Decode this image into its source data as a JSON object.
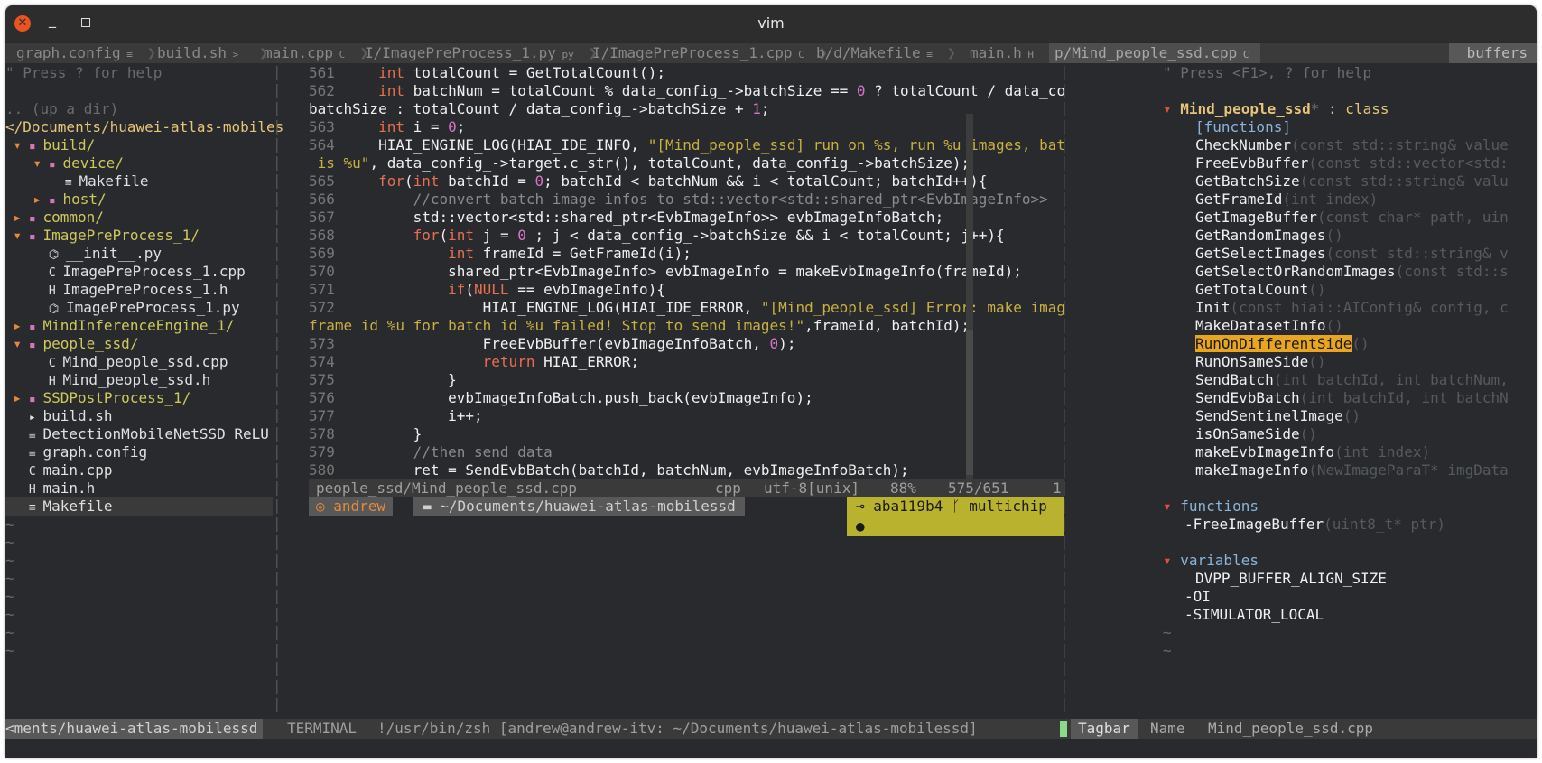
{
  "window": {
    "title": "vim"
  },
  "tabs": [
    {
      "name": "graph.config",
      "icon": "≡"
    },
    {
      "name": "build.sh",
      "icon": ">_"
    },
    {
      "name": "main.cpp",
      "icon": "C"
    },
    {
      "name": "I/ImagePreProcess_1.py",
      "icon": "py"
    },
    {
      "name": "I/ImagePreProcess_1.cpp",
      "icon": "C"
    },
    {
      "name": "b/d/Makefile",
      "icon": "≡"
    },
    {
      "name": "main.h",
      "icon": "H"
    },
    {
      "name": "p/Mind_people_ssd.cpp",
      "icon": "C"
    }
  ],
  "buffers_label": "buffers",
  "tree": {
    "help": "\" Press ? for help",
    "up": ".. (up a dir)",
    "root": "</Documents/huawei-atlas-mobiles",
    "items": [
      {
        "indent": 0,
        "arrow": "▾",
        "type": "dir",
        "name": "build/"
      },
      {
        "indent": 1,
        "arrow": "▾",
        "type": "dir",
        "name": "device/"
      },
      {
        "indent": 2,
        "arrow": "",
        "type": "make",
        "name": "Makefile"
      },
      {
        "indent": 1,
        "arrow": "▸",
        "type": "dir",
        "name": "host/"
      },
      {
        "indent": 0,
        "arrow": "▸",
        "type": "dir",
        "name": "common/"
      },
      {
        "indent": 0,
        "arrow": "▾",
        "type": "dir",
        "name": "ImagePreProcess_1/"
      },
      {
        "indent": 1,
        "arrow": "",
        "type": "py",
        "name": "__init__.py"
      },
      {
        "indent": 1,
        "arrow": "",
        "type": "cpp",
        "name": "ImagePreProcess_1.cpp"
      },
      {
        "indent": 1,
        "arrow": "",
        "type": "h",
        "name": "ImagePreProcess_1.h"
      },
      {
        "indent": 1,
        "arrow": "",
        "type": "py",
        "name": "ImagePreProcess_1.py"
      },
      {
        "indent": 0,
        "arrow": "▸",
        "type": "dir",
        "name": "MindInferenceEngine_1/"
      },
      {
        "indent": 0,
        "arrow": "▾",
        "type": "dir",
        "name": "people_ssd/"
      },
      {
        "indent": 1,
        "arrow": "",
        "type": "cpp",
        "name": "Mind_people_ssd.cpp"
      },
      {
        "indent": 1,
        "arrow": "",
        "type": "h",
        "name": "Mind_people_ssd.h"
      },
      {
        "indent": 0,
        "arrow": "▸",
        "type": "dir",
        "name": "SSDPostProcess_1/"
      },
      {
        "indent": 0,
        "arrow": "",
        "type": "sh",
        "name": "build.sh"
      },
      {
        "indent": 0,
        "arrow": "",
        "type": "make",
        "name": "DetectionMobileNetSSD_ReLU"
      },
      {
        "indent": 0,
        "arrow": "",
        "type": "make",
        "name": "graph.config"
      },
      {
        "indent": 0,
        "arrow": "",
        "type": "cpp",
        "name": "main.cpp"
      },
      {
        "indent": 0,
        "arrow": "",
        "type": "h",
        "name": "main.h"
      },
      {
        "indent": 0,
        "arrow": "",
        "type": "make",
        "name": "Makefile"
      }
    ]
  },
  "code": {
    "lines": [
      {
        "n": "561",
        "html": "    <span class='kw'>int</span> totalCount = GetTotalCount();"
      },
      {
        "n": "562",
        "html": "    <span class='kw'>int</span> batchNum = totalCount % data_config_->batchSize == <span class='num'>0</span> ? totalCount / data_config_->"
      },
      {
        "n": "",
        "html": "batchSize : totalCount / data_config_->batchSize + <span class='num'>1</span>;"
      },
      {
        "n": "563",
        "html": "    <span class='kw'>int</span> i = <span class='num'>0</span>;"
      },
      {
        "n": "564",
        "html": "    HIAI_ENGINE_LOG(HIAI_IDE_INFO, <span class='str'>\"[Mind_people_ssd] run on %s, run %u images, batch size</span>"
      },
      {
        "n": "",
        "html": "<span class='str'> is %u\"</span>, data_config_->target.c_str(), totalCount, data_config_->batchSize);"
      },
      {
        "n": "565",
        "html": "    <span class='kw'>for</span>(<span class='kw'>int</span> batchId = <span class='num'>0</span>; batchId &lt; batchNum &amp;&amp; i &lt; totalCount; batchId++){"
      },
      {
        "n": "566",
        "html": "        <span class='cmt'>//convert batch image infos to std::vector&lt;std::shared_ptr&lt;EvbImageInfo&gt;&gt;</span>"
      },
      {
        "n": "567",
        "html": "        std::vector&lt;std::shared_ptr&lt;EvbImageInfo&gt;&gt; evbImageInfoBatch;"
      },
      {
        "n": "568",
        "html": "        <span class='kw'>for</span>(<span class='kw'>int</span> j = <span class='num'>0</span> ; j &lt; data_config_->batchSize &amp;&amp; i &lt; totalCount; j++){"
      },
      {
        "n": "569",
        "html": "            <span class='kw'>int</span> frameId = GetFrameId(i);"
      },
      {
        "n": "570",
        "html": "            shared_ptr&lt;EvbImageInfo&gt; evbImageInfo = makeEvbImageInfo(frameId);"
      },
      {
        "n": "571",
        "html": "            <span class='kw'>if</span>(<span class='kw'>NULL</span> == evbImageInfo){"
      },
      {
        "n": "572",
        "html": "                HIAI_ENGINE_LOG(HIAI_IDE_ERROR, <span class='str'>\"[Mind_people_ssd] Error: make image info</span>"
      },
      {
        "n": "",
        "html": "<span class='str'>frame id %u for batch id %u failed! Stop to send images!\"</span>,frameId, batchId);"
      },
      {
        "n": "573",
        "html": "                FreeEvbBuffer(evbImageInfoBatch, <span class='num'>0</span>);"
      },
      {
        "n": "574",
        "html": "                <span class='kw'>return</span> HIAI_ERROR;"
      },
      {
        "n": "575",
        "html": "            }"
      },
      {
        "n": "576",
        "html": "            evbImageInfoBatch.push_back(evbImageInfo);"
      },
      {
        "n": "577",
        "html": "            i++;"
      },
      {
        "n": "578",
        "html": "        }"
      },
      {
        "n": "579",
        "html": "        <span class='cmt'>//then send data</span>"
      },
      {
        "n": "580",
        "html": "        ret = SendEvbBatch(batchId, batchNum, evbImageInfoBatch);"
      }
    ],
    "status": {
      "file": "people_ssd/Mind_people_ssd.cpp",
      "ft": "cpp",
      "enc": "utf-8[unix]",
      "pct": "88%",
      "pos": "575/651",
      "col": "1"
    },
    "prompt": {
      "user": "andrew",
      "path": "~/Documents/huawei-atlas-mobilessd",
      "commit": "aba119b4",
      "branch": "multichip"
    }
  },
  "tagbar": {
    "help": "\" Press <F1>, ? for help",
    "class_name": "Mind_people_ssd",
    "class_suffix": " : class",
    "functions_group": "[functions]",
    "members": [
      {
        "name": "CheckNumber",
        "sig": "(const std::string& value"
      },
      {
        "name": "FreeEvbBuffer",
        "sig": "(const std::vector<std:"
      },
      {
        "name": "GetBatchSize",
        "sig": "(const std::string& valu"
      },
      {
        "name": "GetFrameId",
        "sig": "(int index)"
      },
      {
        "name": "GetImageBuffer",
        "sig": "(const char* path, uin"
      },
      {
        "name": "GetRandomImages",
        "sig": "()"
      },
      {
        "name": "GetSelectImages",
        "sig": "(const std::string& v"
      },
      {
        "name": "GetSelectOrRandomImages",
        "sig": "(const std::s"
      },
      {
        "name": "GetTotalCount",
        "sig": "()"
      },
      {
        "name": "Init",
        "sig": "(const hiai::AIConfig& config, c"
      },
      {
        "name": "MakeDatasetInfo",
        "sig": "()"
      },
      {
        "name": "RunOnDifferentSide",
        "sig": "()"
      },
      {
        "name": "RunOnSameSide",
        "sig": "()"
      },
      {
        "name": "SendBatch",
        "sig": "(int batchId, int batchNum,"
      },
      {
        "name": "SendEvbBatch",
        "sig": "(int batchId, int batchN"
      },
      {
        "name": "SendSentinelImage",
        "sig": "()"
      },
      {
        "name": "isOnSameSide",
        "sig": "()"
      },
      {
        "name": "makeEvbImageInfo",
        "sig": "(int index)"
      },
      {
        "name": "makeImageInfo",
        "sig": "(NewImageParaT* imgData"
      }
    ],
    "functions_title": "functions",
    "free_function": {
      "name": "-FreeImageBuffer",
      "sig": "(uint8_t* ptr)"
    },
    "variables_title": "variables",
    "variables": [
      "DVPP_BUFFER_ALIGN_SIZE",
      "-OI",
      "-SIMULATOR_LOCAL"
    ]
  },
  "bottom": {
    "left_path": "<ments/huawei-atlas-mobilessd",
    "terminal": "TERMINAL",
    "shell": "!/usr/bin/zsh [andrew@andrew-itv: ~/Documents/huawei-atlas-mobilessd]",
    "tagbar_label": "Tagbar",
    "name_label": "Name",
    "name_value": "Mind_people_ssd.cpp"
  }
}
